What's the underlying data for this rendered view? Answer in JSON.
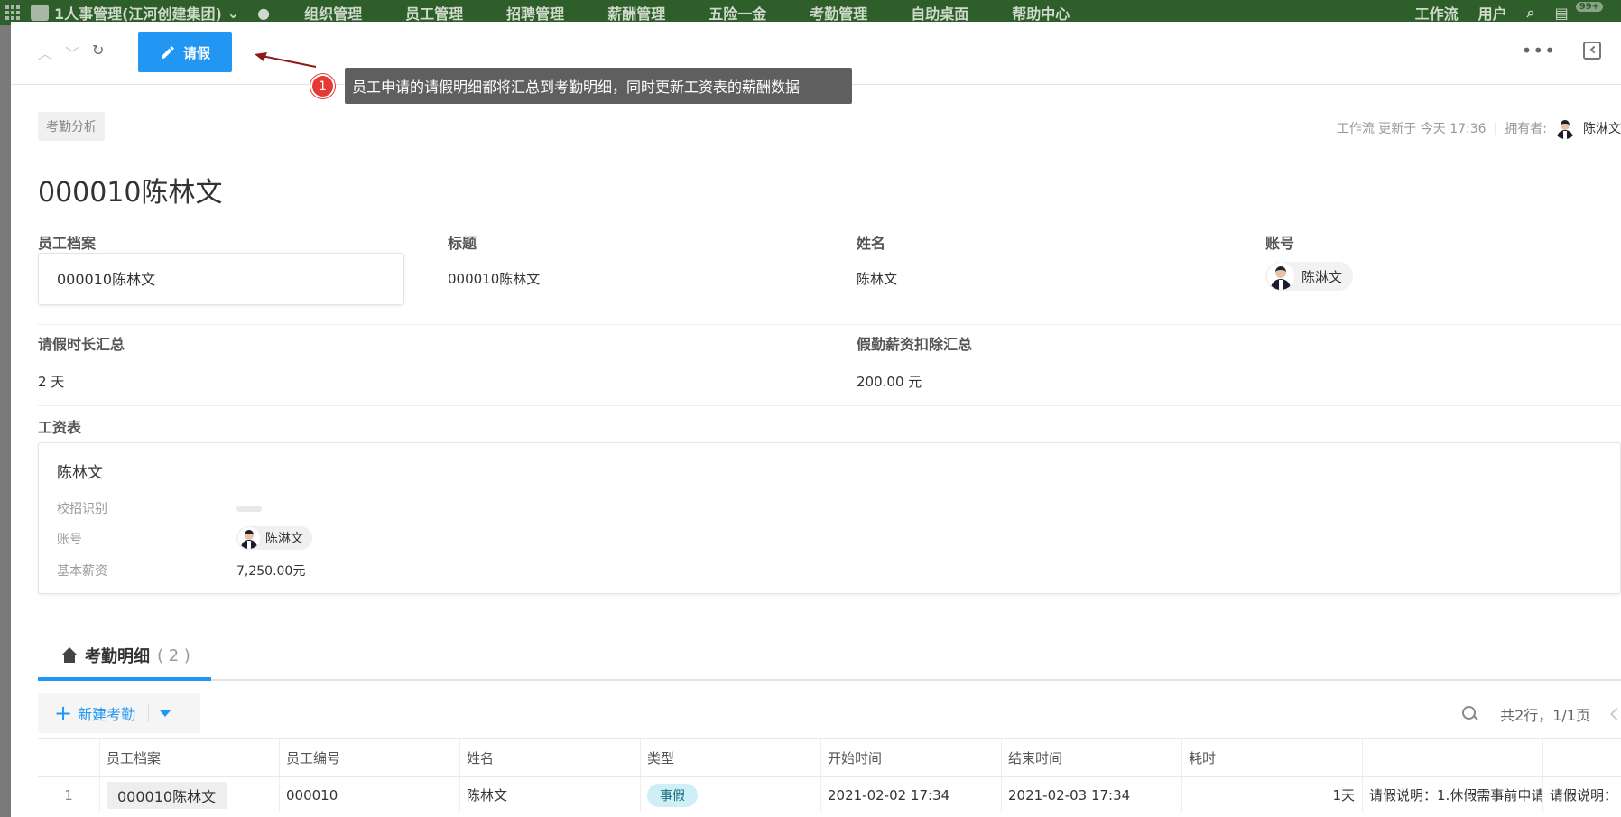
{
  "topnav": {
    "app_title": "1人事管理(江河创建集团)",
    "items": [
      "组织管理",
      "员工管理",
      "招聘管理",
      "薪酬管理",
      "五险一金",
      "考勤管理",
      "自助桌面",
      "帮助中心"
    ],
    "right_items": [
      "工作流",
      "用户"
    ],
    "badge": "99+"
  },
  "toolbar": {
    "leave_label": "请假"
  },
  "annotation": {
    "number": "1",
    "text": "员工申请的请假明细都将汇总到考勤明细，同时更新工资表的薪酬数据"
  },
  "record": {
    "tag": "考勤分析",
    "meta_updated": "工作流 更新于 今天 17:36",
    "meta_owner_label": "拥有者:",
    "meta_owner_name": "陈淋文",
    "title": "000010陈林文"
  },
  "fields": {
    "employee_file_label": "员工档案",
    "employee_file_value": "000010陈林文",
    "subject_label": "标题",
    "subject_value": "000010陈林文",
    "name_label": "姓名",
    "name_value": "陈林文",
    "account_label": "账号",
    "account_value": "陈淋文",
    "leave_total_label": "请假时长汇总",
    "leave_total_value": "2 天",
    "deduction_label": "假勤薪资扣除汇总",
    "deduction_value": "200.00 元",
    "salary_label": "工资表"
  },
  "salary_card": {
    "name": "陈林文",
    "campus_label": "校招识别",
    "account_label": "账号",
    "account_value": "陈淋文",
    "base_label": "基本薪资",
    "base_value": "7,250.00元"
  },
  "tab": {
    "label": "考勤明细",
    "count": "( 2 )"
  },
  "table_toolbar": {
    "new_label": "新建考勤",
    "pager": "共2行，1/1页"
  },
  "table": {
    "headers": [
      "",
      "员工档案",
      "员工编号",
      "姓名",
      "类型",
      "开始时间",
      "结束时间",
      "耗时",
      "",
      ""
    ],
    "rows": [
      [
        "1",
        "000010陈林文",
        "000010",
        "陈林文",
        "事假",
        "2021-02-02 17:34",
        "2021-02-03 17:34",
        "1天",
        "请假说明：1.休假需事前申请",
        "请假说明："
      ]
    ]
  }
}
